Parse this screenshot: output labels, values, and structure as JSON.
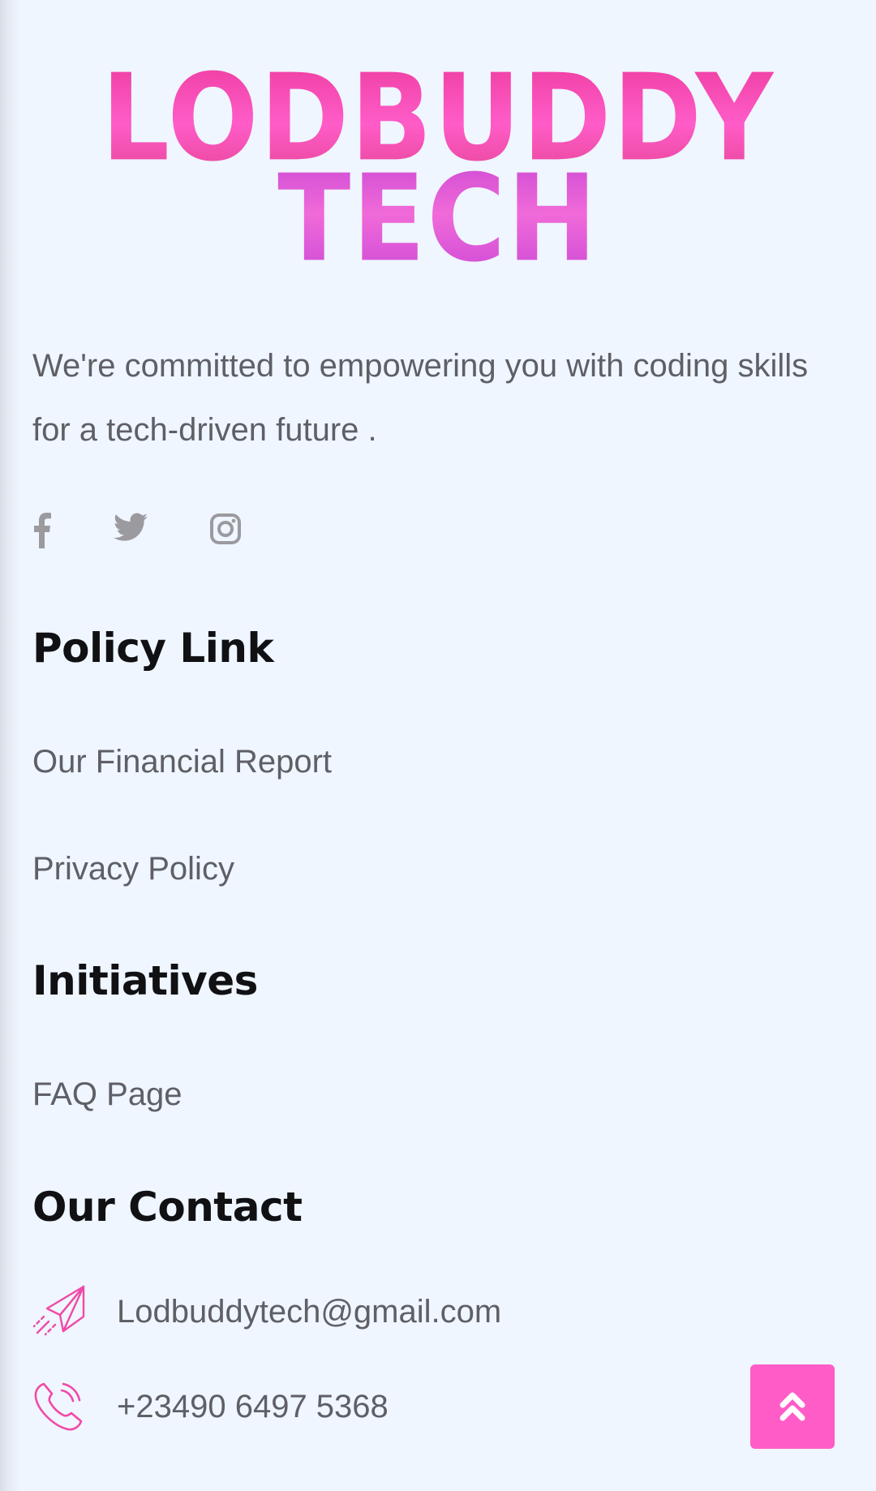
{
  "brand": {
    "logo_line1": "LODBUDDY",
    "logo_line2": "TECH",
    "accent_color": "#ff5cc8"
  },
  "tagline": "We're committed to empowering you with coding skills for a tech-driven future .",
  "socials": [
    {
      "icon": "facebook-icon"
    },
    {
      "icon": "twitter-icon"
    },
    {
      "icon": "instagram-icon"
    }
  ],
  "policy": {
    "heading": "Policy Link",
    "links": [
      "Our Financial Report",
      "Privacy Policy"
    ]
  },
  "initiatives": {
    "heading": "Initiatives",
    "links": [
      "FAQ Page"
    ]
  },
  "contact": {
    "heading": "Our Contact",
    "email": "Lodbuddytech@gmail.com",
    "email_icon": "paper-plane-icon",
    "phone": "+23490 6497 5368",
    "phone_icon": "phone-icon"
  },
  "scroll_top": {
    "icon": "double-chevron-up-icon"
  }
}
